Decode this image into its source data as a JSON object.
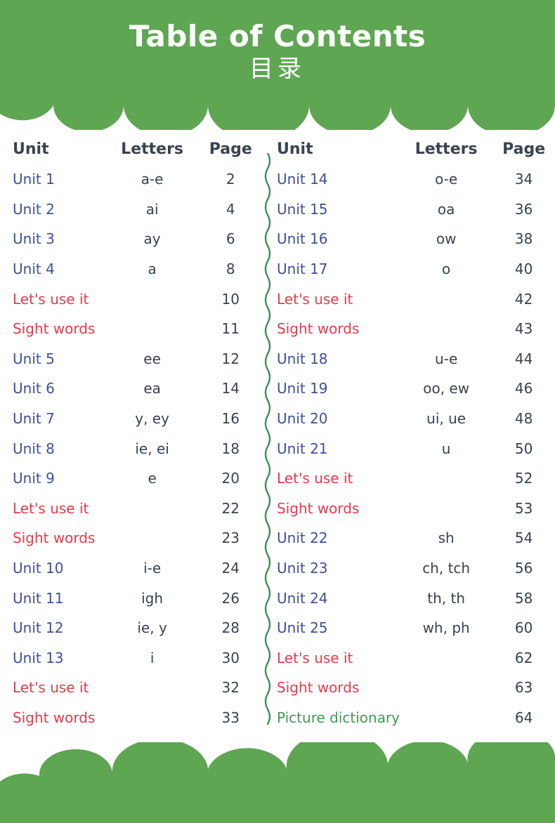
{
  "title": {
    "english": "Table of Contents",
    "chinese": "目录"
  },
  "colors": {
    "banner_green": "#5da551",
    "unit_blue": "#3d4f9e",
    "special_red": "#e8394a",
    "dictionary_green": "#3e9b55",
    "header_slate": "#3a4450",
    "page_number": "#39424e",
    "divider_green": "#3e8f5a"
  },
  "columns": [
    {
      "headers": {
        "unit": "Unit",
        "letters": "Letters",
        "page": "Page"
      },
      "rows": [
        {
          "unit": "Unit 1",
          "letters": "a-e",
          "page": "2",
          "kind": "unit"
        },
        {
          "unit": "Unit 2",
          "letters": "ai",
          "page": "4",
          "kind": "unit"
        },
        {
          "unit": "Unit 3",
          "letters": "ay",
          "page": "6",
          "kind": "unit"
        },
        {
          "unit": "Unit 4",
          "letters": "a",
          "page": "8",
          "kind": "unit"
        },
        {
          "unit": "Let's use it",
          "letters": "",
          "page": "10",
          "kind": "special"
        },
        {
          "unit": "Sight words",
          "letters": "",
          "page": "11",
          "kind": "special"
        },
        {
          "unit": "Unit 5",
          "letters": "ee",
          "page": "12",
          "kind": "unit"
        },
        {
          "unit": "Unit 6",
          "letters": "ea",
          "page": "14",
          "kind": "unit"
        },
        {
          "unit": "Unit 7",
          "letters": "y, ey",
          "page": "16",
          "kind": "unit"
        },
        {
          "unit": "Unit 8",
          "letters": "ie, ei",
          "page": "18",
          "kind": "unit"
        },
        {
          "unit": "Unit 9",
          "letters": "e",
          "page": "20",
          "kind": "unit"
        },
        {
          "unit": "Let's use it",
          "letters": "",
          "page": "22",
          "kind": "special"
        },
        {
          "unit": "Sight words",
          "letters": "",
          "page": "23",
          "kind": "special"
        },
        {
          "unit": "Unit 10",
          "letters": "i-e",
          "page": "24",
          "kind": "unit"
        },
        {
          "unit": "Unit 11",
          "letters": "igh",
          "page": "26",
          "kind": "unit"
        },
        {
          "unit": "Unit 12",
          "letters": "ie, y",
          "page": "28",
          "kind": "unit"
        },
        {
          "unit": "Unit 13",
          "letters": "i",
          "page": "30",
          "kind": "unit"
        },
        {
          "unit": "Let's use it",
          "letters": "",
          "page": "32",
          "kind": "special"
        },
        {
          "unit": "Sight words",
          "letters": "",
          "page": "33",
          "kind": "special"
        }
      ]
    },
    {
      "headers": {
        "unit": "Unit",
        "letters": "Letters",
        "page": "Page"
      },
      "rows": [
        {
          "unit": "Unit 14",
          "letters": "o-e",
          "page": "34",
          "kind": "unit"
        },
        {
          "unit": "Unit 15",
          "letters": "oa",
          "page": "36",
          "kind": "unit"
        },
        {
          "unit": "Unit 16",
          "letters": "ow",
          "page": "38",
          "kind": "unit"
        },
        {
          "unit": "Unit 17",
          "letters": "o",
          "page": "40",
          "kind": "unit"
        },
        {
          "unit": "Let's use it",
          "letters": "",
          "page": "42",
          "kind": "special"
        },
        {
          "unit": "Sight words",
          "letters": "",
          "page": "43",
          "kind": "special"
        },
        {
          "unit": "Unit 18",
          "letters": "u-e",
          "page": "44",
          "kind": "unit"
        },
        {
          "unit": "Unit 19",
          "letters": "oo, ew",
          "page": "46",
          "kind": "unit"
        },
        {
          "unit": "Unit 20",
          "letters": "ui, ue",
          "page": "48",
          "kind": "unit"
        },
        {
          "unit": "Unit 21",
          "letters": "u",
          "page": "50",
          "kind": "unit"
        },
        {
          "unit": "Let's use it",
          "letters": "",
          "page": "52",
          "kind": "special"
        },
        {
          "unit": "Sight words",
          "letters": "",
          "page": "53",
          "kind": "special"
        },
        {
          "unit": "Unit 22",
          "letters": "sh",
          "page": "54",
          "kind": "unit"
        },
        {
          "unit": "Unit 23",
          "letters": "ch, tch",
          "page": "56",
          "kind": "unit"
        },
        {
          "unit": "Unit 24",
          "letters": "th, th",
          "page": "58",
          "kind": "unit"
        },
        {
          "unit": "Unit 25",
          "letters": "wh, ph",
          "page": "60",
          "kind": "unit"
        },
        {
          "unit": "Let's use it",
          "letters": "",
          "page": "62",
          "kind": "special"
        },
        {
          "unit": "Sight words",
          "letters": "",
          "page": "63",
          "kind": "special"
        },
        {
          "unit": "Picture dictionary",
          "letters": "",
          "page": "64",
          "kind": "green"
        }
      ]
    }
  ]
}
